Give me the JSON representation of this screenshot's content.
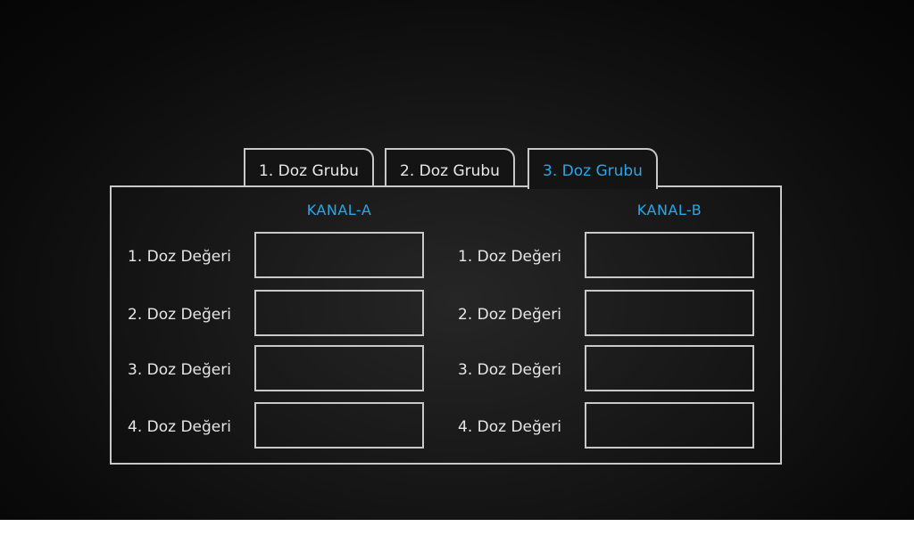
{
  "tabs": [
    {
      "label": "1. Doz Grubu",
      "active": false
    },
    {
      "label": "2. Doz Grubu",
      "active": false
    },
    {
      "label": "3. Doz Grubu",
      "active": true
    }
  ],
  "channels": {
    "a": {
      "title": "KANAL-A",
      "rows": [
        {
          "label": "1. Doz Değeri",
          "value": ""
        },
        {
          "label": "2. Doz Değeri",
          "value": ""
        },
        {
          "label": "3. Doz Değeri",
          "value": ""
        },
        {
          "label": "4. Doz Değeri",
          "value": ""
        }
      ]
    },
    "b": {
      "title": "KANAL-B",
      "rows": [
        {
          "label": "1. Doz Değeri",
          "value": ""
        },
        {
          "label": "2. Doz Değeri",
          "value": ""
        },
        {
          "label": "3. Doz Değeri",
          "value": ""
        },
        {
          "label": "4. Doz Değeri",
          "value": ""
        }
      ]
    }
  },
  "colors": {
    "accent": "#2ba6e6",
    "border": "#c8c8c8",
    "text": "#e6e6e6",
    "background": "#111111"
  }
}
